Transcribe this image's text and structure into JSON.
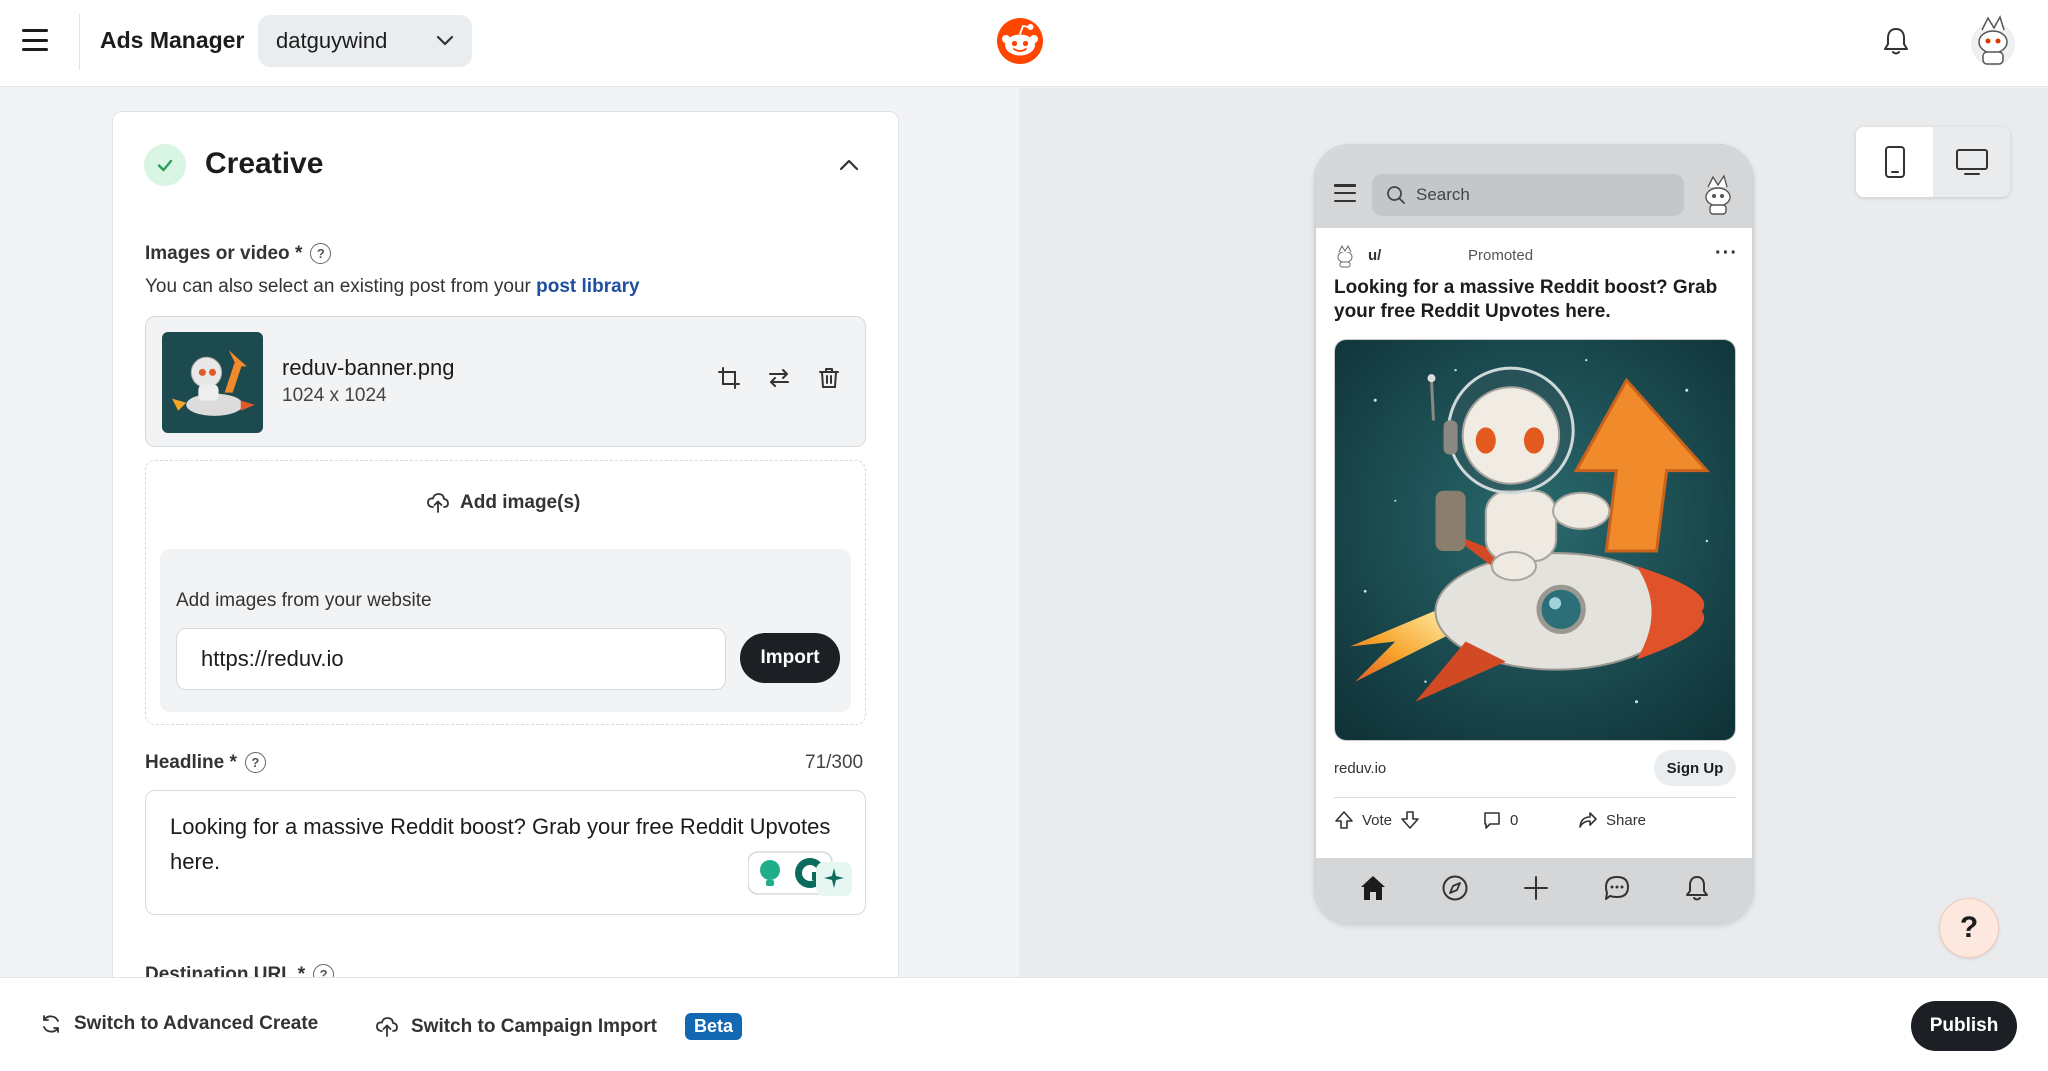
{
  "header": {
    "app_title": "Ads Manager",
    "account": "datguywind",
    "icons": [
      "menu-icon",
      "chevron-down-icon",
      "reddit-logo",
      "bell-icon",
      "avatar"
    ]
  },
  "creative": {
    "title": "Creative",
    "images_label": "Images or video *",
    "library_hint": "You can also select an existing post from your",
    "library_link": "post library",
    "file": {
      "name": "reduv-banner.png",
      "dims": "1024 x 1024"
    },
    "add_images": "Add image(s)",
    "website_label": "Add images from your website",
    "website_url": "https://reduv.io",
    "import_label": "Import",
    "headline_label": "Headline *",
    "headline_count": "71/300",
    "headline_value": "Looking for a massive Reddit boost? Grab your free Reddit Upvotes here.",
    "destination_label": "Destination URL *"
  },
  "preview": {
    "search_placeholder": "Search",
    "user": "u/",
    "promoted": "Promoted",
    "more": "···",
    "title": "Looking for a massive Reddit boost? Grab your free Reddit Upvotes here.",
    "domain": "reduv.io",
    "cta": "Sign Up",
    "vote": "Vote",
    "comments": "0",
    "share": "Share"
  },
  "help_fab": "?",
  "footer": {
    "advanced_create": "Switch to Advanced Create",
    "campaign_import": "Switch to Campaign Import",
    "beta": "Beta",
    "publish": "Publish"
  },
  "colors": {
    "brand": "#ff4500",
    "link": "#1f4fa0",
    "dark_button": "#1c2024",
    "beta_badge": "#1368b3",
    "success_bg": "#d9f5e3",
    "success": "#2e9e5b"
  }
}
